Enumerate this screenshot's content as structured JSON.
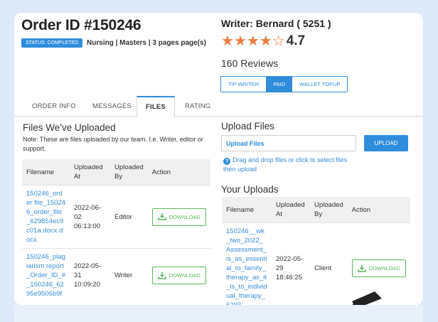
{
  "order": {
    "title": "Order ID #150246",
    "status_badge": "STATUS: COMPLETED",
    "details": "Nursing | Masters | 3 pages page(s)"
  },
  "writer": {
    "name": "Writer: Bernard ( 5251 )",
    "rating": "4.7",
    "stars_filled": 4,
    "stars_total": 5,
    "reviews": "160 Reviews",
    "buttons": [
      "TIP WRITER",
      "PAID",
      "WALLET TOPUP"
    ]
  },
  "tabs": [
    "ORDER INFO",
    "MESSAGES",
    "FILES",
    "RATING"
  ],
  "files_section": {
    "heading": "Files We've Uploaded",
    "note": "Note: These are files uploaded by our team. I.e. Writer, editor or support.",
    "columns": [
      "Filename",
      "Uploaded At",
      "Uploaded By",
      "Action"
    ],
    "rows": [
      {
        "filename": "150246_order file_150246_order_file_629854ec9c01a.docx.docx",
        "uploaded_at": "2022-06-02 06:13:00",
        "uploaded_by": "Editor",
        "action": "DOWNLOAD"
      },
      {
        "filename": "150246_plagiarism report_Order_ID_#_150246_6295e9506b9f",
        "uploaded_at": "2022-05-31 10:09:20",
        "uploaded_by": "Writer",
        "action": "DOWNLOAD"
      }
    ]
  },
  "upload_section": {
    "heading": "Upload Files",
    "input_label": "Upload Files",
    "upload_button": "UPLOAD",
    "help_text": "Drag and drop files or click to select files then upload"
  },
  "uploads_section": {
    "heading": "Your Uploads",
    "columns": [
      "Filename",
      "Uploaded At",
      "Uploaded By",
      "Action"
    ],
    "rows": [
      {
        "filename": "150246__wk_two_2022_Assessment_is_as_essential_to_family_therapy_as_it_is_to_individual_therapy_6293",
        "uploaded_at": "2022-05-29 18:46:25",
        "uploaded_by": "Client",
        "action": "DOWNLOAD"
      }
    ]
  },
  "colors": {
    "accent": "#2f8ddc",
    "star": "#f07d3c",
    "download": "#5cb85c"
  },
  "icons": {
    "download": "download-icon",
    "help": "question-circle-icon",
    "star": "star-icon"
  }
}
